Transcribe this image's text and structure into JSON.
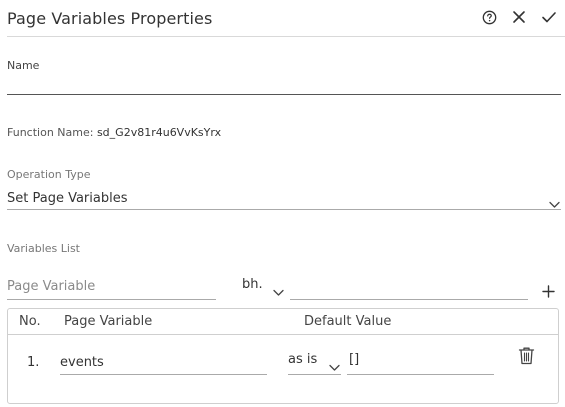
{
  "header": {
    "title": "Page Variables Properties",
    "icons": [
      "help-circle-icon",
      "close-icon",
      "check-icon"
    ]
  },
  "name_field": {
    "label": "Name",
    "value": ""
  },
  "function_name": {
    "label": "Function Name:",
    "value": "sd_G2v81r4u6VvKsYrx"
  },
  "operation_type": {
    "label": "Operation Type",
    "value": "Set Page Variables"
  },
  "variables_list": {
    "label": "Variables List",
    "new_row": {
      "page_variable_placeholder": "Page Variable",
      "mode": "bh.",
      "value": ""
    },
    "table": {
      "headers": [
        "No.",
        "Page Variable",
        "Default Value"
      ],
      "rows": [
        {
          "no": "1.",
          "page_variable": "events",
          "mode": "as is",
          "default_value": "[]"
        }
      ]
    }
  }
}
